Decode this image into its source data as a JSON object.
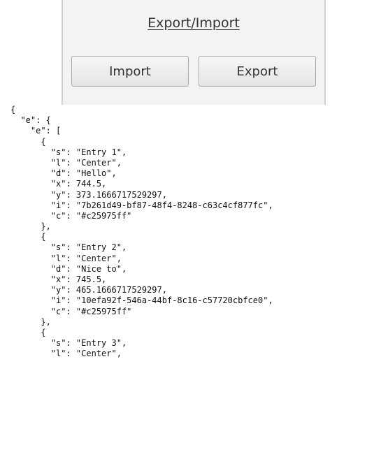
{
  "panel": {
    "title": "Export/Import",
    "import_label": "Import",
    "export_label": "Export"
  },
  "json_text": [
    "{",
    "  \"e\": {",
    "    \"e\": [",
    "      {",
    "        \"s\": \"Entry 1\",",
    "        \"l\": \"Center\",",
    "        \"d\": \"Hello\",",
    "        \"x\": 744.5,",
    "        \"y\": 373.1666717529297,",
    "        \"i\": \"7b261d49-bf87-48f4-8248-c63c4cf877fc\",",
    "        \"c\": \"#c25975ff\"",
    "      },",
    "      {",
    "        \"s\": \"Entry 2\",",
    "        \"l\": \"Center\",",
    "        \"d\": \"Nice to\",",
    "        \"x\": 745.5,",
    "        \"y\": 465.1666717529297,",
    "        \"i\": \"10efa92f-546a-44bf-8c16-c57720cbfce0\",",
    "        \"c\": \"#c25975ff\"",
    "      },",
    "      {",
    "        \"s\": \"Entry 3\",",
    "        \"l\": \"Center\","
  ]
}
